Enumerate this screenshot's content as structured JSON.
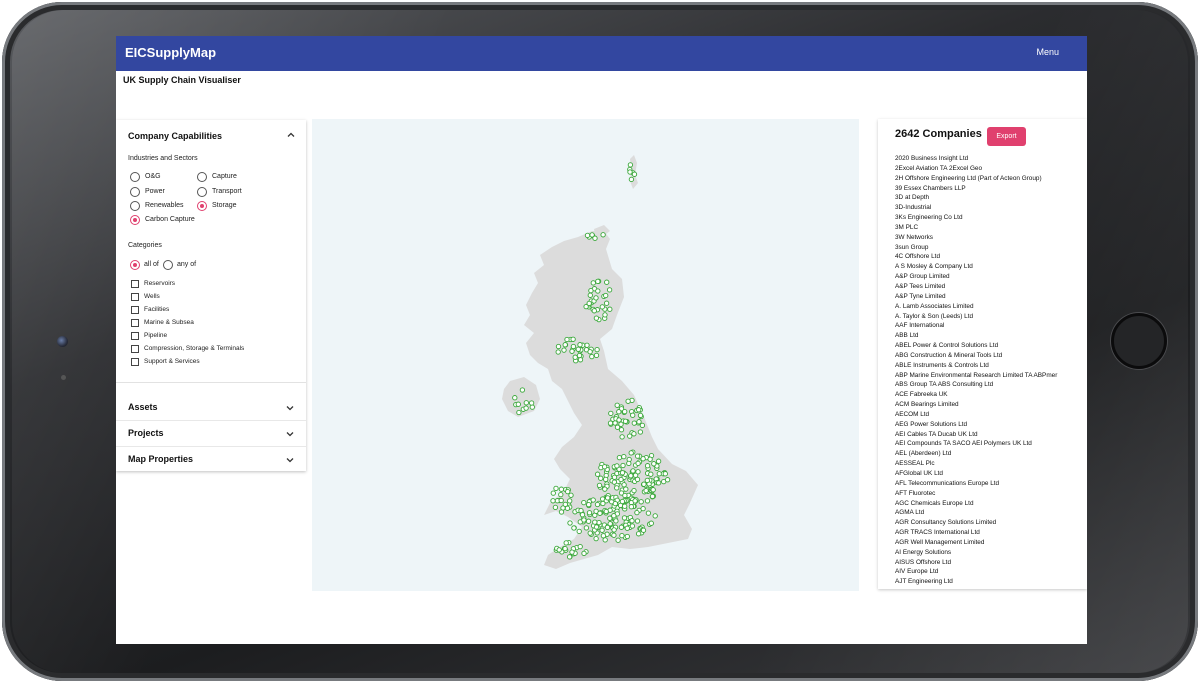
{
  "app": {
    "brand": "EICSupplyMap",
    "menu_label": "Menu",
    "subtitle": "UK Supply Chain Visualiser"
  },
  "colors": {
    "header_bg": "#3347a0",
    "accent": "#e0406e",
    "map_bg": "#eef5f8",
    "land": "#dcdcdc",
    "marker": "#3aa83a"
  },
  "filters": {
    "title": "Company Capabilities",
    "industries_label": "Industries and Sectors",
    "industries": [
      {
        "label": "O&G",
        "selected": false
      },
      {
        "label": "Power",
        "selected": false
      },
      {
        "label": "Renewables",
        "selected": false
      },
      {
        "label": "Carbon Capture",
        "selected": true
      },
      {
        "label": "Capture",
        "selected": false
      },
      {
        "label": "Transport",
        "selected": false
      },
      {
        "label": "Storage",
        "selected": true
      }
    ],
    "categories_label": "Categories",
    "match": [
      {
        "label": "all of",
        "selected": true
      },
      {
        "label": "any of",
        "selected": false
      }
    ],
    "categories": [
      {
        "label": "Reservoirs",
        "checked": false
      },
      {
        "label": "Wells",
        "checked": false
      },
      {
        "label": "Facilities",
        "checked": false
      },
      {
        "label": "Marine & Subsea",
        "checked": false
      },
      {
        "label": "Pipeline",
        "checked": false
      },
      {
        "label": "Compression, Storage & Terminals",
        "checked": false
      },
      {
        "label": "Support & Services",
        "checked": false
      }
    ]
  },
  "accordions": [
    {
      "label": "Assets"
    },
    {
      "label": "Projects"
    },
    {
      "label": "Map Properties"
    }
  ],
  "results": {
    "count_label": "2642 Companies",
    "export_label": "Export",
    "companies": [
      "2020 Business Insight Ltd",
      "2Excel Aviation TA 2Excel Geo",
      "2H Offshore Engineering Ltd (Part of Acteon Group)",
      "39 Essex Chambers LLP",
      "3D at Depth",
      "3D-Industrial",
      "3Ks Engineering Co Ltd",
      "3M PLC",
      "3W Networks",
      "3sun Group",
      "4C Offshore Ltd",
      "A S Mosley & Company Ltd",
      "A&P Group Limited",
      "A&P Tees Limited",
      "A&P Tyne Limited",
      "A. Lamb Associates Limited",
      "A. Taylor & Son (Leeds) Ltd",
      "AAF International",
      "ABB Ltd",
      "ABEL Power & Control Solutions Ltd",
      "ABG Construction & Mineral Tools Ltd",
      "ABLE Instruments & Controls Ltd",
      "ABP Marine Environmental Research Limited TA ABPmer",
      "ABS Group TA ABS Consulting Ltd",
      "ACE Fabreeka UK",
      "ACM Bearings Limited",
      "AECOM Ltd",
      "AEG Power Solutions Ltd",
      "AEI Cables TA Ducab UK Ltd",
      "AEI Compounds TA SACO AEI Polymers UK Ltd",
      "AEL (Aberdeen) Ltd",
      "AESSEAL Plc",
      "AFGlobal UK Ltd",
      "AFL Telecommunications Europe Ltd",
      "AFT Fluorotec",
      "AGC Chemicals Europe Ltd",
      "AGMA Ltd",
      "AGR Consultancy Solutions Limited",
      "AGR TRACS International Ltd",
      "AGR Well Management Limited",
      "AI Energy Solutions",
      "AISUS Offshore Ltd",
      "AIV Europe Ltd",
      "AJT Engineering Ltd"
    ]
  }
}
